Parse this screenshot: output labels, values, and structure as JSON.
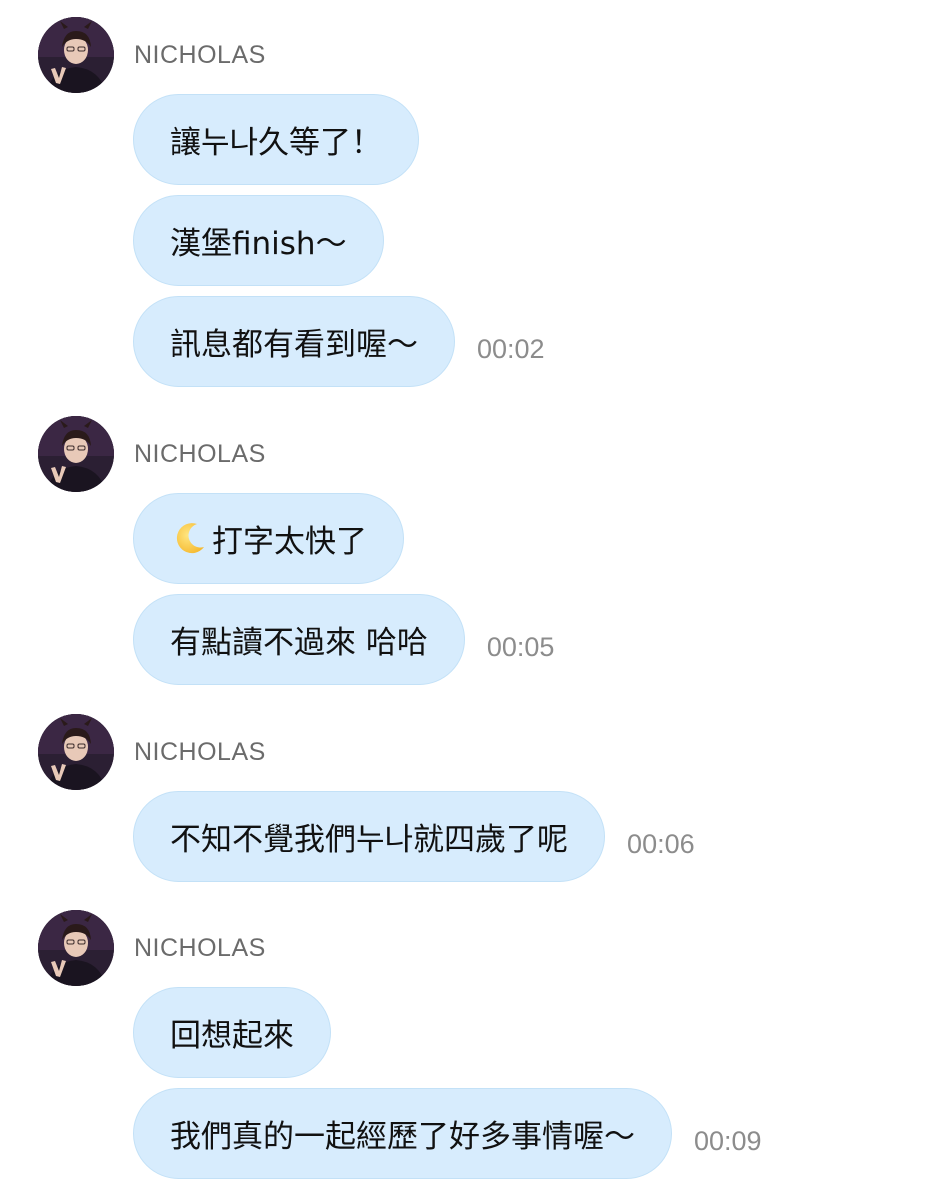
{
  "groups": [
    {
      "sender": "NICHOLAS",
      "messages": [
        {
          "text": "讓누나久等了！",
          "time": ""
        },
        {
          "text": "漢堡finish～",
          "time": ""
        },
        {
          "text": "訊息都有看到喔～",
          "time": "00:02"
        }
      ]
    },
    {
      "sender": "NICHOLAS",
      "messages": [
        {
          "emoji": "crescent-moon-icon",
          "text": "打字太快了",
          "time": ""
        },
        {
          "text": "有點讀不過來 哈哈",
          "time": "00:05"
        }
      ]
    },
    {
      "sender": "NICHOLAS",
      "messages": [
        {
          "text": "不知不覺我們누나就四歲了呢",
          "time": "00:06"
        }
      ]
    },
    {
      "sender": "NICHOLAS",
      "messages": [
        {
          "text": "回想起來",
          "time": ""
        },
        {
          "text": "我們真的一起經歷了好多事情喔～",
          "time": "00:09"
        }
      ]
    }
  ],
  "colors": {
    "bubble": "#d7ecfd",
    "bubble_border": "#c3e1f7",
    "sender_name": "#6b6b6b",
    "timestamp": "#8c8c8c",
    "text": "#111111"
  }
}
